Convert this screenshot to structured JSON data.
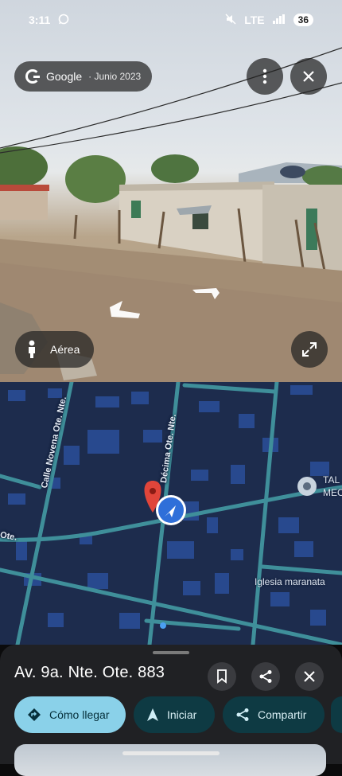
{
  "status_bar": {
    "time": "3:11",
    "network": "LTE",
    "battery": "36"
  },
  "streetview": {
    "brand": "Google",
    "date": "· Junio 2023",
    "aerial_label": "Aérea"
  },
  "map": {
    "streets": [
      "Calle Novena Ote. Nte.",
      "Décima Ote. Nte.",
      "Ote."
    ],
    "poi": {
      "name_line1": "TAL",
      "name_line2": "MEC",
      "church": "Iglesia maranata"
    }
  },
  "sheet": {
    "address": "Av. 9a. Nte. Ote. 883",
    "actions": {
      "directions": "Cómo llegar",
      "start": "Iniciar",
      "share": "Compartir"
    }
  },
  "colors": {
    "map_bg": "#1d2c4d",
    "road": "#3f8f9a",
    "accent": "#8ad1e9",
    "sheet_bg": "#202124"
  }
}
